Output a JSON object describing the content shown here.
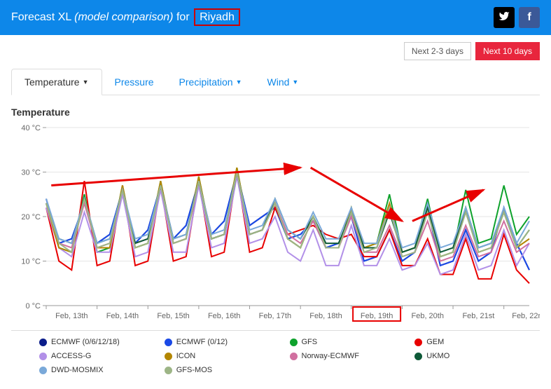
{
  "header": {
    "title_prefix": "Forecast XL",
    "title_mid": "(model comparison)",
    "title_for": "for",
    "city": "Riyadh"
  },
  "range_buttons": {
    "days_23": "Next 2-3 days",
    "days_10": "Next 10 days"
  },
  "tabs": {
    "temperature": "Temperature",
    "pressure": "Pressure",
    "precipitation": "Precipitation",
    "wind": "Wind"
  },
  "chart_title": "Temperature",
  "chart_data": {
    "type": "line",
    "title": "Temperature",
    "xlabel": "",
    "ylabel": "°C",
    "ylim": [
      0,
      40
    ],
    "y_ticks": [
      0,
      10,
      20,
      30,
      40
    ],
    "y_tick_labels": [
      "0 °C",
      "10 °C",
      "20 °C",
      "30 °C",
      "40 °C"
    ],
    "x_tick_labels": [
      "Feb, 13th",
      "Feb, 14th",
      "Feb, 15th",
      "Feb, 16th",
      "Feb, 17th",
      "Feb, 18th",
      "Feb, 19th",
      "Feb, 20th",
      "Feb, 21st",
      "Feb, 22nd"
    ],
    "categories_x": [
      0,
      0.25,
      0.5,
      0.75,
      1,
      1.25,
      1.5,
      1.75,
      2,
      2.25,
      2.5,
      2.75,
      3,
      3.25,
      3.5,
      3.75,
      4,
      4.25,
      4.5,
      4.75,
      5,
      5.25,
      5.5,
      5.75,
      6,
      6.25,
      6.5,
      6.75,
      7,
      7.25,
      7.5,
      7.75,
      8,
      8.25,
      8.5,
      8.75,
      9,
      9.25,
      9.5
    ],
    "series": [
      {
        "name": "ECMWF (0/6/12/18)",
        "color": "#0b1d8a",
        "values": [
          24,
          14,
          15,
          23,
          14,
          16,
          26,
          14,
          17,
          27,
          15,
          18,
          28,
          16,
          19,
          30,
          18,
          20,
          22,
          15,
          16,
          19,
          13,
          14,
          20,
          10,
          11,
          17,
          10,
          12,
          22,
          9,
          10,
          17,
          10,
          12,
          22,
          14,
          8
        ]
      },
      {
        "name": "ECMWF (0/12)",
        "color": "#1a49e6",
        "values": [
          24,
          14,
          15,
          23,
          14,
          16,
          26,
          14,
          17,
          27,
          15,
          18,
          28,
          16,
          19,
          30,
          18,
          20,
          22,
          15,
          16,
          19,
          13,
          14,
          20,
          10,
          11,
          17,
          10,
          12,
          22,
          9,
          10,
          17,
          10,
          12,
          22,
          14,
          8
        ]
      },
      {
        "name": "GFS",
        "color": "#0ea22c",
        "values": [
          23,
          13,
          12,
          25,
          12,
          13,
          27,
          13,
          14,
          28,
          14,
          15,
          29,
          15,
          16,
          31,
          16,
          17,
          23,
          15,
          13,
          20,
          13,
          13,
          22,
          13,
          14,
          25,
          12,
          13,
          24,
          11,
          12,
          26,
          14,
          15,
          27,
          16,
          20
        ]
      },
      {
        "name": "GEM",
        "color": "#e80000",
        "values": [
          22,
          10,
          8,
          28,
          9,
          10,
          27,
          9,
          10,
          27,
          10,
          11,
          28,
          11,
          12,
          30,
          12,
          13,
          22,
          16,
          17,
          18,
          16,
          15,
          16,
          11,
          11,
          17,
          9,
          9,
          15,
          7,
          7,
          15,
          6,
          6,
          16,
          8,
          5
        ]
      },
      {
        "name": "ACCESS-G",
        "color": "#b290e8",
        "values": [
          22,
          13,
          11,
          21,
          12,
          12,
          25,
          11,
          12,
          26,
          12,
          12,
          27,
          13,
          14,
          29,
          14,
          15,
          20,
          12,
          10,
          17,
          9,
          9,
          18,
          9,
          9,
          15,
          8,
          9,
          14,
          7,
          8,
          16,
          8,
          9,
          17,
          9,
          14
        ]
      },
      {
        "name": "ICON",
        "color": "#b38600",
        "values": [
          23,
          13,
          12,
          24,
          13,
          13,
          27,
          13,
          14,
          28,
          14,
          15,
          29,
          15,
          16,
          31,
          16,
          17,
          23,
          15,
          13,
          20,
          13,
          13,
          22,
          13,
          14,
          23,
          12,
          13,
          22,
          11,
          12,
          22,
          12,
          13,
          21,
          13,
          15
        ]
      },
      {
        "name": "Norway-ECMWF",
        "color": "#d170a0",
        "values": [
          23,
          14,
          13,
          23,
          13,
          14,
          26,
          14,
          15,
          27,
          14,
          15,
          28,
          15,
          16,
          30,
          16,
          17,
          23,
          16,
          14,
          19,
          13,
          13,
          20,
          12,
          12,
          18,
          11,
          12,
          19,
          10,
          11,
          18,
          11,
          12,
          19,
          12,
          14
        ]
      },
      {
        "name": "UKMO",
        "color": "#0e5a38",
        "values": [
          23,
          15,
          14,
          24,
          14,
          15,
          26,
          14,
          15,
          27,
          15,
          16,
          28,
          15,
          16,
          30,
          16,
          17,
          24,
          17,
          15,
          20,
          14,
          14,
          21,
          13,
          13,
          21,
          12,
          13,
          22,
          12,
          13,
          22,
          13,
          14,
          21,
          13,
          17
        ]
      },
      {
        "name": "DWD-MOSMIX",
        "color": "#7aa9d9",
        "values": [
          24,
          15,
          14,
          24,
          14,
          15,
          26,
          15,
          16,
          27,
          15,
          16,
          28,
          16,
          17,
          30,
          17,
          18,
          24,
          17,
          15,
          21,
          15,
          15,
          22,
          14,
          14,
          22,
          13,
          14,
          23,
          13,
          14,
          22,
          13,
          14,
          22,
          14,
          19
        ]
      },
      {
        "name": "GFS-MOS",
        "color": "#9db586",
        "values": [
          23,
          14,
          12,
          24,
          13,
          14,
          26,
          13,
          14,
          27,
          14,
          15,
          28,
          15,
          16,
          30,
          16,
          17,
          23,
          15,
          13,
          20,
          13,
          13,
          21,
          12,
          13,
          22,
          11,
          12,
          21,
          11,
          12,
          21,
          12,
          13,
          21,
          13,
          17
        ]
      }
    ],
    "annotations": {
      "arrows": [
        {
          "from_x": 0.1,
          "from_y": 27,
          "to_x": 5.0,
          "to_y": 31
        },
        {
          "from_x": 5.2,
          "from_y": 31,
          "to_x": 7.0,
          "to_y": 19
        },
        {
          "from_x": 7.2,
          "from_y": 19,
          "to_x": 8.6,
          "to_y": 26
        }
      ],
      "highlight_x_label": "Feb, 19th",
      "highlight_city": true
    }
  }
}
